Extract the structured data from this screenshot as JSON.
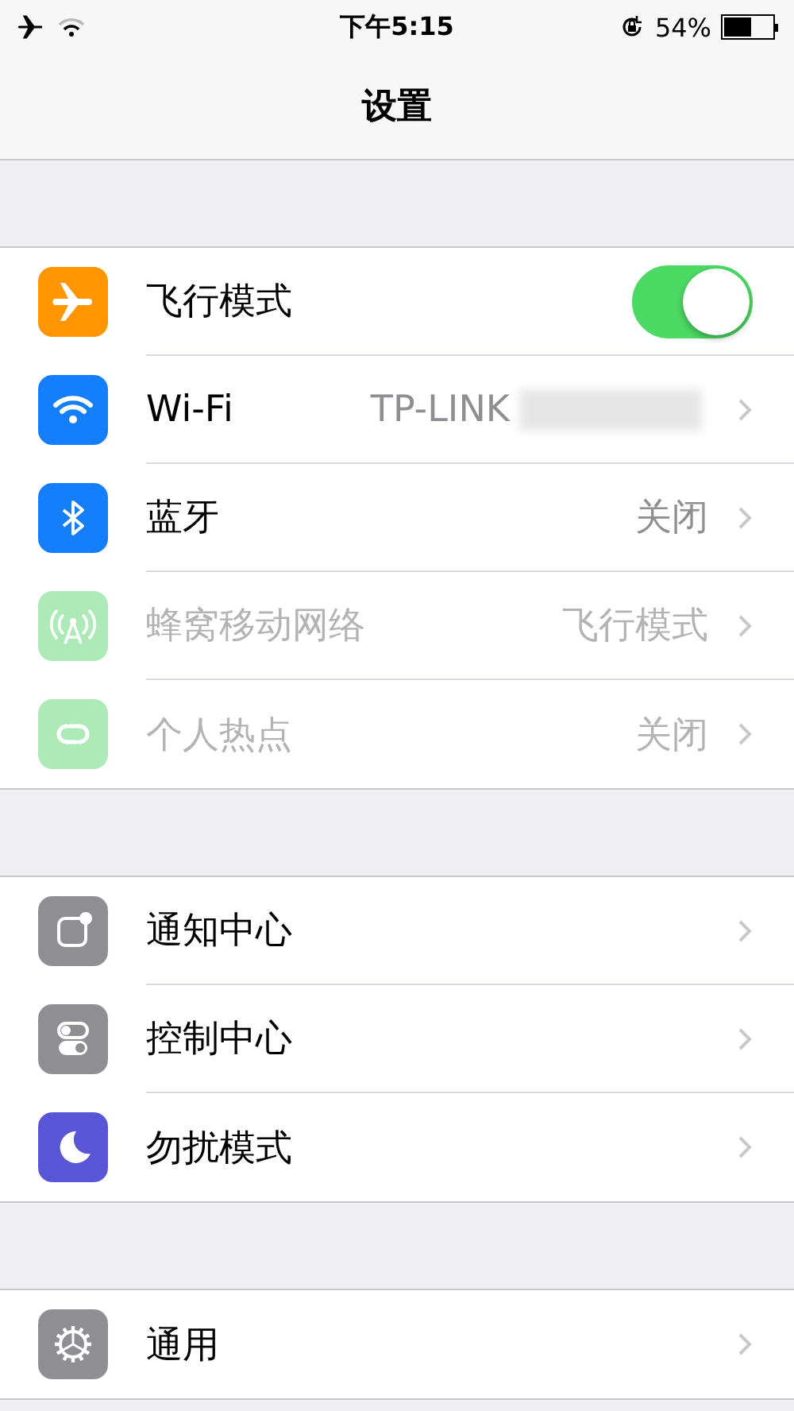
{
  "status_bar": {
    "airplane_mode": true,
    "time": "下午5:15",
    "battery_text": "54%"
  },
  "nav_bar": {
    "title": "设置"
  },
  "sections": [
    {
      "items": [
        {
          "label": "飞行模式",
          "color": "#ff9500",
          "kind": "toggle",
          "on": true,
          "disabled": false
        },
        {
          "label": "Wi-Fi",
          "color": "#157efb",
          "kind": "link",
          "value": "TP-LINK",
          "redacted": true,
          "disabled": false
        },
        {
          "label": "蓝牙",
          "color": "#157efb",
          "kind": "link",
          "value": "关闭",
          "disabled": false
        },
        {
          "label": "蜂窝移动网络",
          "color": "#aee9b8",
          "kind": "link",
          "value": "飞行模式",
          "disabled": true
        },
        {
          "label": "个人热点",
          "color": "#aee9b8",
          "kind": "link",
          "value": "关闭",
          "disabled": true
        }
      ]
    },
    {
      "items": [
        {
          "label": "通知中心",
          "color": "#8e8e93",
          "kind": "link",
          "disabled": false
        },
        {
          "label": "控制中心",
          "color": "#8e8e93",
          "kind": "link",
          "disabled": false
        },
        {
          "label": "勿扰模式",
          "color": "#5856d6",
          "kind": "link",
          "disabled": false
        }
      ]
    },
    {
      "items": [
        {
          "label": "通用",
          "color": "#8e8e93",
          "kind": "link",
          "disabled": false
        }
      ]
    }
  ]
}
